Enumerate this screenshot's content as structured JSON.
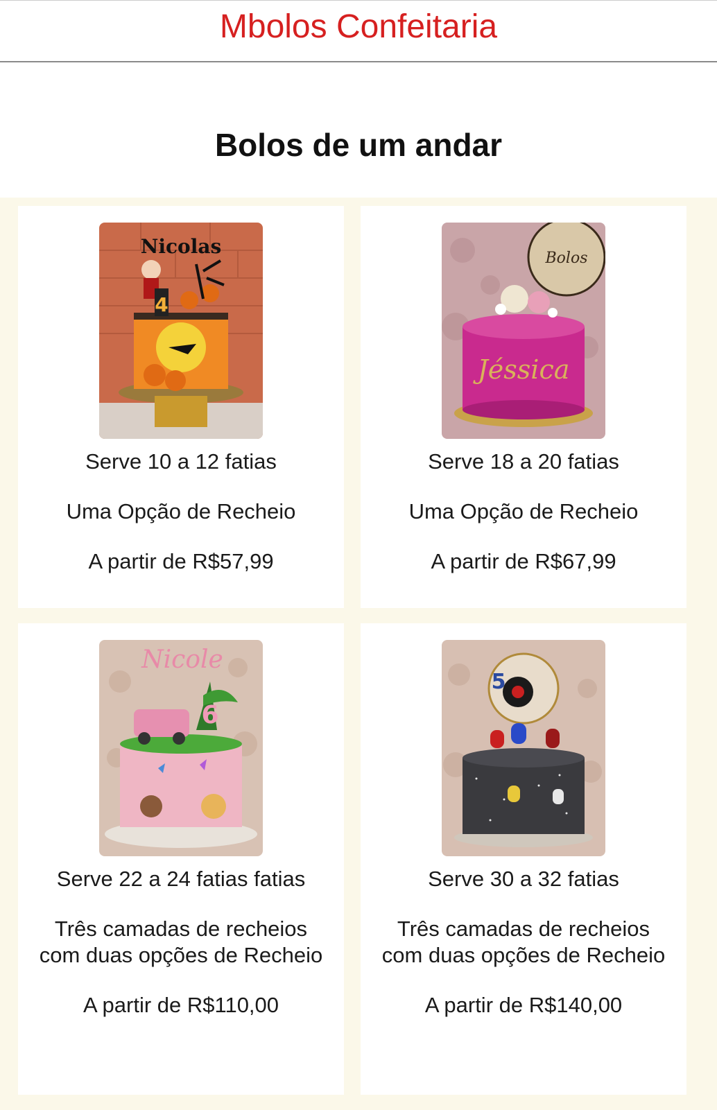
{
  "header": {
    "brand": "Mbolos Confeitaria"
  },
  "section": {
    "title": "Bolos de um andar"
  },
  "products": [
    {
      "serves": "Serve 10 a 12 fatias",
      "filling": "Uma Opção de Recheio",
      "price": "A partir de R$57,99",
      "photo_icon": "halloween-cake-photo"
    },
    {
      "serves": "Serve 18 a 20 fatias",
      "filling": "Uma Opção de Recheio",
      "price": "A partir de R$67,99",
      "photo_icon": "pink-glitter-cake-photo"
    },
    {
      "serves": "Serve 22 a 24 fatias fatias",
      "filling": "Três camadas de recheios com duas opções de Recheio",
      "price": "A partir de R$110,00",
      "photo_icon": "safari-cake-photo"
    },
    {
      "serves": "Serve 30 a 32 fatias",
      "filling": "Três camadas de recheios com duas opções de Recheio",
      "price": "A partir de R$140,00",
      "photo_icon": "among-us-cake-photo"
    }
  ],
  "colors": {
    "brand": "#d62020",
    "grid_background": "#fbf8e9",
    "card_background": "#ffffff"
  }
}
